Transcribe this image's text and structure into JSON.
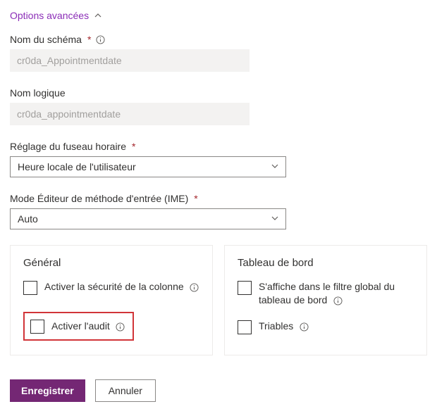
{
  "toggle": {
    "label": "Options avancées"
  },
  "schema_name": {
    "label": "Nom du schéma",
    "value": "cr0da_Appointmentdate",
    "required": true
  },
  "logical_name": {
    "label": "Nom logique",
    "value": "cr0da_appointmentdate",
    "required": false
  },
  "timezone": {
    "label": "Réglage du fuseau horaire",
    "value": "Heure locale de l'utilisateur",
    "required": true
  },
  "ime_mode": {
    "label": "Mode Éditeur de méthode d'entrée (IME)",
    "value": "Auto",
    "required": true
  },
  "general_card": {
    "title": "Général",
    "col_security": "Activer la sécurité de la colonne",
    "audit": "Activer l'audit"
  },
  "dashboard_card": {
    "title": "Tableau de bord",
    "global_filter": "S'affiche dans le filtre global du tableau de bord",
    "sortable": "Triables"
  },
  "buttons": {
    "save": "Enregistrer",
    "cancel": "Annuler"
  }
}
